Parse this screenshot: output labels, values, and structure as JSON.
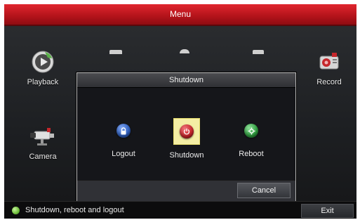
{
  "window": {
    "title": "Menu"
  },
  "main_menu": {
    "playback": {
      "label": "Playback",
      "icon": "playback-icon"
    },
    "camera": {
      "label": "Camera",
      "icon": "camera-icon"
    },
    "record": {
      "label": "Record",
      "icon": "record-icon"
    }
  },
  "dialog": {
    "title": "Shutdown",
    "options": [
      {
        "label": "Logout",
        "icon": "lock-icon",
        "color": "#2f5fbf",
        "selected": false
      },
      {
        "label": "Shutdown",
        "icon": "power-icon",
        "color": "#c6242a",
        "selected": true
      },
      {
        "label": "Reboot",
        "icon": "gear-icon",
        "color": "#2f9e3f",
        "selected": false
      }
    ],
    "cancel_label": "Cancel"
  },
  "status_bar": {
    "text": "Shutdown, reboot and logout",
    "exit_label": "Exit",
    "led_color": "#6fbd3b"
  },
  "colors": {
    "title_bar": "#b2131a",
    "selected_highlight": "#f4eea4"
  }
}
